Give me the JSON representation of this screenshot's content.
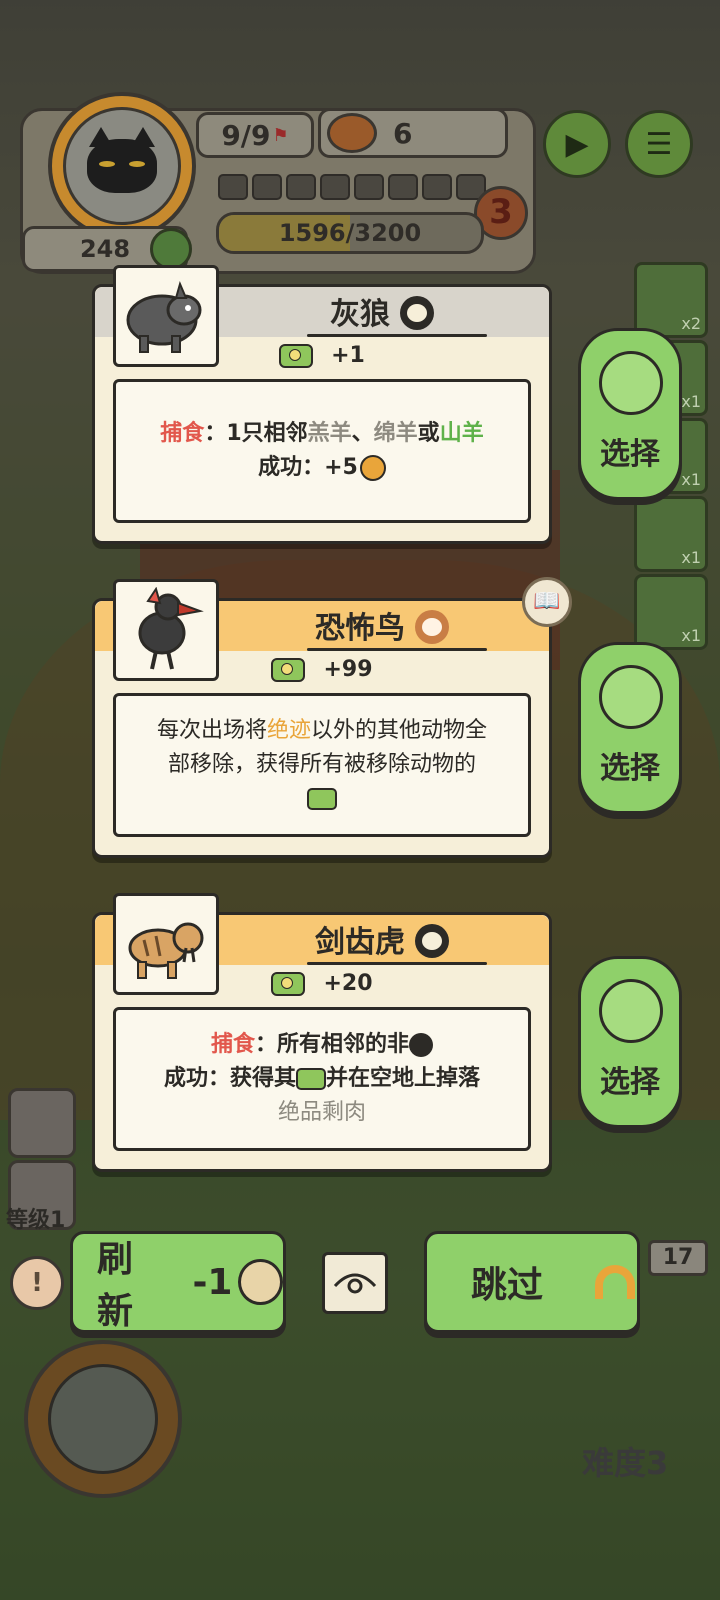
{
  "hud": {
    "round": "9/9",
    "cans": "6",
    "coins": "248",
    "progress_text": "1596/3200",
    "progress_fraction": 0.499,
    "level_badge": "3",
    "segments_filled": 0,
    "segments_total": 8
  },
  "side_counts": [
    "x2",
    "x1",
    "x1",
    "x1",
    "x1"
  ],
  "cards": [
    {
      "name": "灰狼",
      "value": "+1",
      "header_color": "#d8d4cb",
      "desc_line1_a": "捕食",
      "desc_line1_b": "：1只相邻",
      "desc_line1_c": "羔羊",
      "desc_line1_d": "、",
      "desc_line1_e": "绵羊",
      "desc_line1_f": "或",
      "desc_line1_g": "山羊",
      "desc_line2": "成功：+5",
      "select_label": "选择"
    },
    {
      "name": "恐怖鸟",
      "value": "+99",
      "header_color": "#f8c874",
      "desc_line1_a": "每次出场将",
      "desc_line1_b": "绝迹",
      "desc_line1_c": "以外的其他动物全",
      "desc_line2": "部移除，获得所有被移除动物的",
      "select_label": "选择"
    },
    {
      "name": "剑齿虎",
      "value": "+20",
      "header_color": "#f8c874",
      "desc_line1_a": "捕食",
      "desc_line1_b": "：所有相邻的非",
      "desc_line2_a": "成功：获得其",
      "desc_line2_b": "并在空地上掉落",
      "desc_line3": "绝品剩肉",
      "select_label": "选择"
    }
  ],
  "bottom": {
    "refresh_label": "刷新",
    "refresh_cost": "-1",
    "skip_label": "跳过",
    "level_label": "等级1",
    "count": "17",
    "difficulty": "难度3"
  },
  "colors": {
    "accent_green": "#8fd06a",
    "predation_red": "#e2574c",
    "extinct_gold": "#e9a53a"
  }
}
